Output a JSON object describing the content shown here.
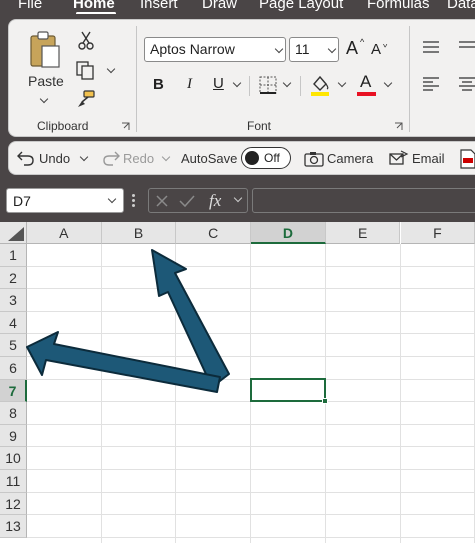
{
  "menu_tabs": [
    "File",
    "Home",
    "Insert",
    "Draw",
    "Page Layout",
    "Formulas",
    "Data"
  ],
  "active_tab": "Home",
  "ribbon": {
    "clipboard": {
      "paste_label": "Paste",
      "group_label": "Clipboard"
    },
    "font": {
      "font_name": "Aptos Narrow",
      "font_size": "11",
      "bold": "B",
      "italic": "I",
      "underline": "U",
      "group_label": "Font",
      "grow_glyph": "A",
      "shrink_glyph": "A",
      "font_color_glyph": "A"
    },
    "colors": {
      "highlight": "#ffe600",
      "font_color": "#e81123",
      "accent": "#1d6b3c",
      "arrow_fill": "#1d5877",
      "arrow_stroke": "#0c2b3b"
    }
  },
  "quick_access": {
    "undo": "Undo",
    "redo": "Redo",
    "autosave": "AutoSave",
    "autosave_state": "Off",
    "camera": "Camera",
    "email": "Email"
  },
  "formula_bar": {
    "name_box": "D7",
    "fx": "fx"
  },
  "sheet": {
    "columns": [
      "A",
      "B",
      "C",
      "D",
      "E",
      "F"
    ],
    "rows": [
      "1",
      "2",
      "3",
      "4",
      "5",
      "6",
      "7",
      "8",
      "9",
      "10",
      "11",
      "12",
      "13"
    ],
    "active_cell": "D7",
    "active_column": "D",
    "active_row": "7"
  }
}
